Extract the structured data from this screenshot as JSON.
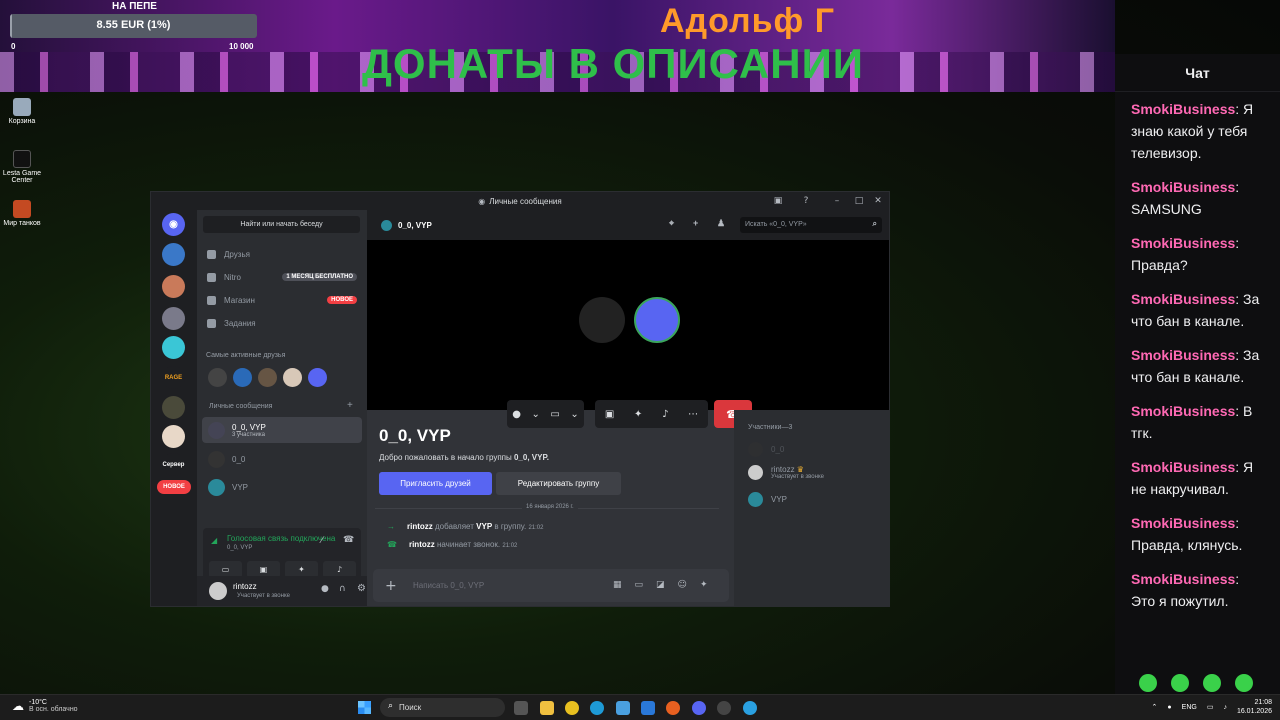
{
  "overlay": {
    "goal_label": "НА ПЕПЕ",
    "goal_value": "8.55 EUR (1%)",
    "goal_progress": 0.01,
    "goal_min": "0",
    "goal_max": "10 000",
    "streamer_name": "Адольф Г",
    "donate_text": "ДОНАТЫ В ОПИСАНИИ"
  },
  "desktop": {
    "icons": [
      "Корзина",
      "Lesta Game Center",
      "Мир танков"
    ]
  },
  "chat": {
    "title": "Чат",
    "messages": [
      {
        "user": "SmokiBusiness",
        "text": "Я знаю какой у тебя телевизор."
      },
      {
        "user": "SmokiBusiness",
        "text": "SAMSUNG"
      },
      {
        "user": "SmokiBusiness",
        "text": "Правда?"
      },
      {
        "user": "SmokiBusiness",
        "text": "За что бан в канале."
      },
      {
        "user": "SmokiBusiness",
        "text": "За что бан в канале."
      },
      {
        "user": "SmokiBusiness",
        "text": "В тгк."
      },
      {
        "user": "SmokiBusiness",
        "text": "Я не накручивал."
      },
      {
        "user": "SmokiBusiness",
        "text": "Правда, клянусь."
      },
      {
        "user": "SmokiBusiness",
        "text": "Это я пожутил."
      }
    ]
  },
  "discord": {
    "window_title": "Личные сообщения",
    "find_button": "Найти или начать беседу",
    "nav": {
      "friends": "Друзья",
      "nitro": "Nitro",
      "nitro_badge": "1 МЕСЯЦ БЕСПЛАТНО",
      "shop": "Магазин",
      "shop_badge": "НОВОЕ",
      "quests": "Задания"
    },
    "active_friends_label": "Самые активные друзья",
    "dm_label": "Личные сообщения",
    "dms": [
      {
        "name": "0_0, VYP",
        "sub": "3 участника"
      },
      {
        "name": "0_0",
        "sub": ""
      },
      {
        "name": "VYP",
        "sub": ""
      }
    ],
    "servers": [
      "RAGE",
      "Сервер"
    ],
    "server_new_badge": "НОВОЕ",
    "voice": {
      "status": "Голосовая связь подключена",
      "channel": "0_0, VYP"
    },
    "user": {
      "name": "rintozz",
      "status": "Участвует в звонке"
    },
    "channel": {
      "title": "0_0, VYP",
      "search_placeholder": "Искать «0_0, VYP»",
      "heading": "0_0, VYP",
      "welcome_prefix": "Добро пожаловать в начало группы ",
      "welcome_name": "0_0, VYP.",
      "invite_button": "Пригласить друзей",
      "edit_button": "Редактировать группу",
      "date_divider": "16 января 2026 г.",
      "system_messages": [
        {
          "user": "rintozz",
          "action": "добавляет",
          "target": "VYP",
          "suffix": "в группу.",
          "time": "21:02"
        },
        {
          "user": "rintozz",
          "action": "начинает звонок.",
          "target": "",
          "suffix": "",
          "time": "21:02"
        }
      ],
      "composer_placeholder": "Написать 0_0, VYP"
    },
    "members": {
      "header": "Участники—3",
      "list": [
        {
          "name": "0_0",
          "status": ""
        },
        {
          "name": "rintozz",
          "status": "Участвует в звонке"
        },
        {
          "name": "VYP",
          "status": ""
        }
      ]
    }
  },
  "taskbar": {
    "temperature": "-10°C",
    "weather": "В осн. облачно",
    "search_placeholder": "Поиск",
    "language": "ENG",
    "time": "21:08",
    "date": "16.01.2026"
  }
}
